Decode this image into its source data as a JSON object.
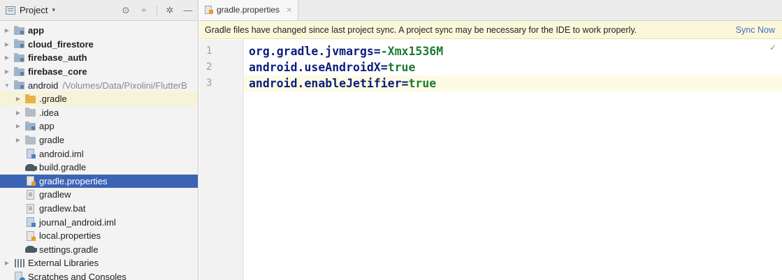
{
  "project_panel": {
    "title": "Project",
    "tools": [
      "target-icon",
      "collapse-icon",
      "gear-icon",
      "minimize-icon"
    ],
    "tree": [
      {
        "label": "app",
        "bold": true,
        "arrow": "collapsed",
        "icon": "module-folder-icon",
        "indent": 0
      },
      {
        "label": "cloud_firestore",
        "bold": true,
        "arrow": "collapsed",
        "icon": "module-folder-icon",
        "indent": 0
      },
      {
        "label": "firebase_auth",
        "bold": true,
        "arrow": "collapsed",
        "icon": "module-folder-icon",
        "indent": 0
      },
      {
        "label": "firebase_core",
        "bold": true,
        "arrow": "collapsed",
        "icon": "module-folder-icon",
        "indent": 0
      },
      {
        "label": "android",
        "path": "/Volumes/Data/Pixolini/FlutterB",
        "bold": false,
        "arrow": "expanded",
        "icon": "module-folder-icon",
        "indent": 0
      },
      {
        "label": ".gradle",
        "arrow": "collapsed",
        "icon": "orange-folder-icon",
        "indent": 1,
        "highlight": true
      },
      {
        "label": ".idea",
        "arrow": "collapsed",
        "icon": "folder-icon",
        "indent": 1
      },
      {
        "label": "app",
        "arrow": "collapsed",
        "icon": "module-folder-icon",
        "indent": 1
      },
      {
        "label": "gradle",
        "arrow": "collapsed",
        "icon": "folder-icon",
        "indent": 1
      },
      {
        "label": "android.iml",
        "arrow": "none",
        "icon": "iml-file-icon",
        "indent": 1
      },
      {
        "label": "build.gradle",
        "arrow": "none",
        "icon": "gradle-elephant-icon",
        "indent": 1
      },
      {
        "label": "gradle.properties",
        "arrow": "none",
        "icon": "properties-file-icon",
        "indent": 1,
        "selected": true
      },
      {
        "label": "gradlew",
        "arrow": "none",
        "icon": "text-file-icon",
        "indent": 1
      },
      {
        "label": "gradlew.bat",
        "arrow": "none",
        "icon": "text-file-icon",
        "indent": 1
      },
      {
        "label": "journal_android.iml",
        "arrow": "none",
        "icon": "iml-file-icon",
        "indent": 1
      },
      {
        "label": "local.properties",
        "arrow": "none",
        "icon": "properties-file-icon",
        "indent": 1
      },
      {
        "label": "settings.gradle",
        "arrow": "none",
        "icon": "gradle-elephant-icon",
        "indent": 1
      },
      {
        "label": "External Libraries",
        "arrow": "collapsed",
        "icon": "libraries-icon",
        "indent": 0
      },
      {
        "label": "Scratches and Consoles",
        "arrow": "none",
        "icon": "scratches-icon",
        "indent": 0
      }
    ]
  },
  "editor": {
    "tab_label": "gradle.properties",
    "banner_text": "Gradle files have changed since last project sync. A project sync may be necessary for the IDE to work properly.",
    "banner_link": "Sync Now",
    "lines": [
      {
        "number": "1",
        "key": "org.gradle.jvmargs=",
        "value": "-Xmx1536M"
      },
      {
        "number": "2",
        "key": "android.useAndroidX=",
        "value": "true"
      },
      {
        "number": "3",
        "key": "android.enableJetifier=",
        "value": "true",
        "current": true
      }
    ]
  },
  "colors": {
    "selection": "#3d63b6",
    "banner_bg": "#fbf7d9",
    "code_key": "#0a1f7a",
    "code_value": "#1d7b33",
    "link": "#3d6fc3"
  }
}
